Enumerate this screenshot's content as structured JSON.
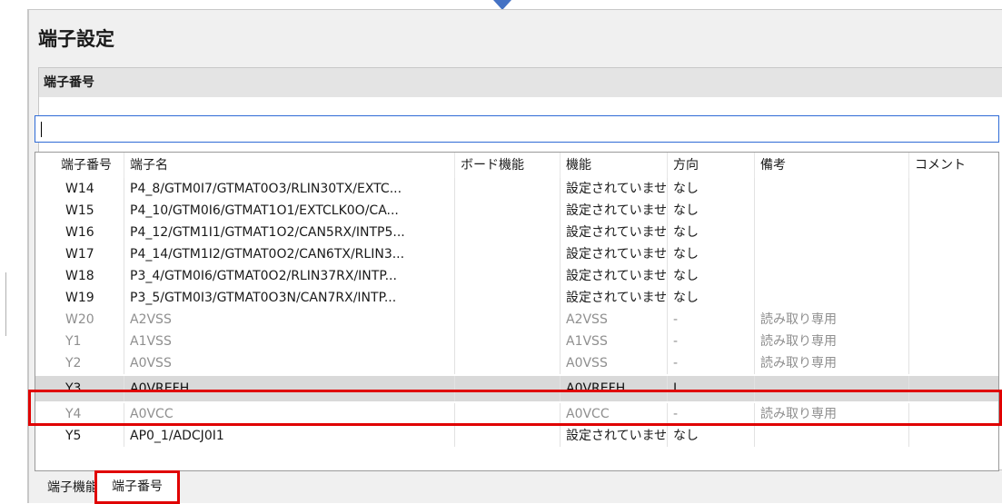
{
  "panel": {
    "title": "端子設定"
  },
  "section": {
    "header": "端子番号"
  },
  "search": {
    "value": ""
  },
  "table": {
    "columns": [
      "端子番号",
      "端子名",
      "ボード機能",
      "機能",
      "方向",
      "備考",
      "コメント"
    ],
    "rows": [
      {
        "pin": "W14",
        "name": "P4_8/GTM0I7/GTMAT0O3/RLIN30TX/EXTC...",
        "board": "",
        "function": "設定されていませ",
        "direction": "なし",
        "note": "",
        "comment": "",
        "state": "normal"
      },
      {
        "pin": "W15",
        "name": "P4_10/GTM0I6/GTMAT1O1/EXTCLK0O/CA...",
        "board": "",
        "function": "設定されていませ",
        "direction": "なし",
        "note": "",
        "comment": "",
        "state": "normal"
      },
      {
        "pin": "W16",
        "name": "P4_12/GTM1I1/GTMAT1O2/CAN5RX/INTP5...",
        "board": "",
        "function": "設定されていませ",
        "direction": "なし",
        "note": "",
        "comment": "",
        "state": "normal"
      },
      {
        "pin": "W17",
        "name": "P4_14/GTM1I2/GTMAT0O2/CAN6TX/RLIN3...",
        "board": "",
        "function": "設定されていませ",
        "direction": "なし",
        "note": "",
        "comment": "",
        "state": "normal"
      },
      {
        "pin": "W18",
        "name": "P3_4/GTM0I6/GTMAT0O2/RLIN37RX/INTP...",
        "board": "",
        "function": "設定されていませ",
        "direction": "なし",
        "note": "",
        "comment": "",
        "state": "normal"
      },
      {
        "pin": "W19",
        "name": "P3_5/GTM0I3/GTMAT0O3N/CAN7RX/INTP...",
        "board": "",
        "function": "設定されていませ",
        "direction": "なし",
        "note": "",
        "comment": "",
        "state": "normal"
      },
      {
        "pin": "W20",
        "name": "A2VSS",
        "board": "",
        "function": "A2VSS",
        "direction": "-",
        "note": "読み取り専用",
        "comment": "",
        "state": "readonly"
      },
      {
        "pin": "Y1",
        "name": "A1VSS",
        "board": "",
        "function": "A1VSS",
        "direction": "-",
        "note": "読み取り専用",
        "comment": "",
        "state": "readonly"
      },
      {
        "pin": "Y2",
        "name": "A0VSS",
        "board": "",
        "function": "A0VSS",
        "direction": "-",
        "note": "読み取り専用",
        "comment": "",
        "state": "readonly"
      },
      {
        "pin": "Y3",
        "name": "A0VREFH",
        "board": "",
        "function": "A0VREFH",
        "direction": "I",
        "note": "",
        "comment": "",
        "state": "selected"
      },
      {
        "pin": "Y4",
        "name": "A0VCC",
        "board": "",
        "function": "A0VCC",
        "direction": "-",
        "note": "読み取り専用",
        "comment": "",
        "state": "readonly"
      },
      {
        "pin": "Y5",
        "name": "AP0_1/ADCJ0I1",
        "board": "",
        "function": "設定されていませ",
        "direction": "なし",
        "note": "",
        "comment": "",
        "state": "normal"
      }
    ]
  },
  "tabs": [
    {
      "label": "端子機能",
      "active": false
    },
    {
      "label": "端子番号",
      "active": true
    }
  ],
  "colors": {
    "highlight": "#e00000",
    "arrow": "#4472c4",
    "selected_row": "#d9d9d9"
  }
}
